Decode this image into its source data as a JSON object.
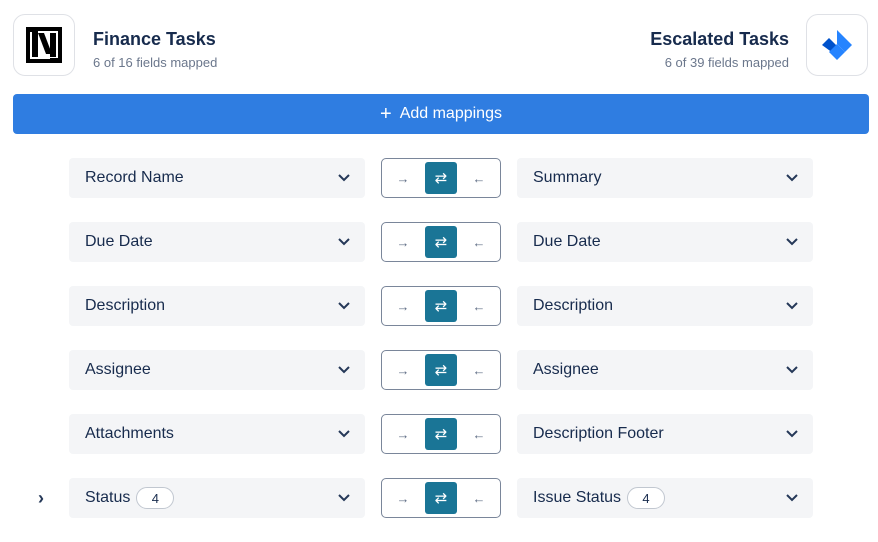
{
  "header": {
    "left": {
      "title": "Finance Tasks",
      "subtitle": "6 of 16 fields mapped",
      "logo_icon": "netsuite-logo",
      "logo_text": "N"
    },
    "right": {
      "title": "Escalated Tasks",
      "subtitle": "6 of 39 fields mapped",
      "logo_icon": "jira-logo",
      "logo_color": "#2684ff"
    }
  },
  "add_button": {
    "icon": "plus-icon",
    "symbol": "+",
    "label": "Add mappings",
    "color": "#2f7de1"
  },
  "direction": {
    "right_arrow": "→",
    "both_arrow": "⇄",
    "left_arrow": "←",
    "active_color": "#1a7596"
  },
  "expand_symbol": "›",
  "rows": [
    {
      "left": "Record Name",
      "right": "Summary",
      "direction": "both"
    },
    {
      "left": "Due Date",
      "right": "Due Date",
      "direction": "both"
    },
    {
      "left": "Description",
      "right": "Description",
      "direction": "both"
    },
    {
      "left": "Assignee",
      "right": "Assignee",
      "direction": "both"
    },
    {
      "left": "Attachments",
      "right": "Description Footer",
      "direction": "both"
    },
    {
      "left": "Status",
      "left_badge": "4",
      "right": "Issue Status",
      "right_badge": "4",
      "direction": "both",
      "expandable": true
    }
  ]
}
